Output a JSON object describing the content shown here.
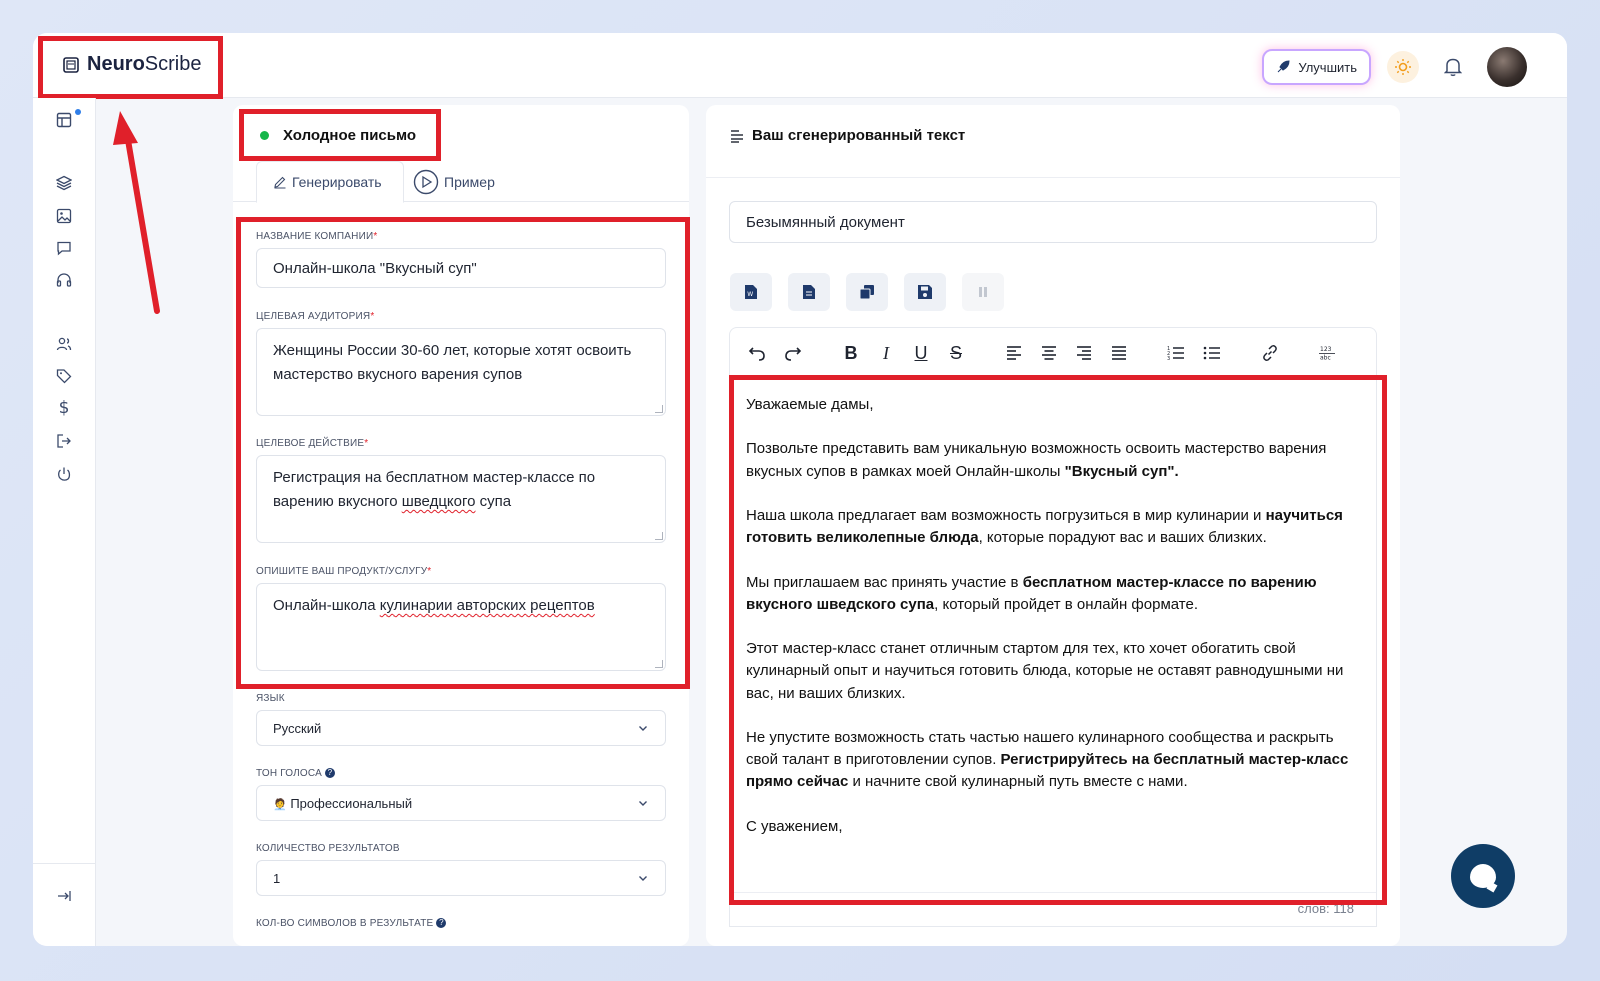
{
  "brand": {
    "name_bold": "Neuro",
    "name_light": "Scribe"
  },
  "header": {
    "upgrade_label": "Улучшить"
  },
  "sidebar": {
    "items": [
      "dashboard-icon",
      "layers-icon",
      "image-icon",
      "chat-icon",
      "headphones-icon",
      "users-icon",
      "tag-icon",
      "dollar-icon",
      "logout-icon",
      "power-icon"
    ],
    "collapse_icon": "collapse-icon"
  },
  "form": {
    "title": "Холодное письмо",
    "tabs": {
      "generate": "Генерировать",
      "example": "Пример"
    },
    "company": {
      "label": "НАЗВАНИЕ КОМПАНИИ",
      "value": "Онлайн-школа \"Вкусный суп\""
    },
    "audience": {
      "label": "ЦЕЛЕВАЯ АУДИТОРИЯ",
      "value": "Женщины России 30-60 лет, которые хотят освоить мастерство вкусного варения супов"
    },
    "action": {
      "label": "ЦЕЛЕВОЕ ДЕЙСТВИЕ",
      "value_a": "Регистрация на бесплатном мастер-классе по варению вкусного ",
      "value_b": "шведцкого",
      "value_c": " супа"
    },
    "product": {
      "label": "ОПИШИТЕ ВАШ ПРОДУКТ/УСЛУГУ",
      "value_a": "Онлайн-школа ",
      "value_b": "кулинарии авторских рецептов"
    },
    "language": {
      "label": "ЯЗЫК",
      "value": "Русский"
    },
    "tone": {
      "label": "ТОН ГОЛОСА",
      "value": "Профессиональный",
      "emoji": "🧑‍💼"
    },
    "results": {
      "label": "КОЛИЧЕСТВО РЕЗУЛЬТАТОВ",
      "value": "1"
    },
    "chars": {
      "label": "КОЛ-ВО СИМВОЛОВ В РЕЗУЛЬТАТЕ"
    }
  },
  "output": {
    "header": "Ваш сгенерированный текст",
    "doc_name": "Безымянный документ",
    "actions": [
      "word-icon",
      "doc-icon",
      "copy-icon",
      "save-icon",
      "pause-icon"
    ],
    "toolbar": [
      "undo-icon",
      "redo-icon",
      "bold-icon",
      "italic-icon",
      "underline-icon",
      "strikethrough-icon",
      "align-left-icon",
      "align-center-icon",
      "align-right-icon",
      "align-justify-icon",
      "ordered-list-icon",
      "bullet-list-icon",
      "link-icon",
      "spellcheck-icon"
    ],
    "p1": "Уважаемые дамы,",
    "p2a": "Позвольте представить вам уникальную возможность освоить мастерство варения вкусных супов в рамках моей Онлайн-школы ",
    "p2b": "\"Вкусный суп\".",
    "p3a": "Наша школа предлагает вам возможность погрузиться в мир кулинарии и ",
    "p3b": "научиться готовить великолепные блюда",
    "p3c": ", которые порадуют вас и ваших близких.",
    "p4a": "Мы приглашаем вас принять участие в ",
    "p4b": "бесплатном мастер-классе по варению вкусного шведского супа",
    "p4c": ", который пройдет в онлайн формате.",
    "p5": "Этот мастер-класс станет отличным стартом для тех, кто хочет обогатить свой кулинарный опыт и научиться готовить блюда, которые не оставят равнодушными ни вас, ни ваших близких.",
    "p6a": "Не упустите возможность стать частью нашего кулинарного сообщества и раскрыть свой талант в приготовлении супов. ",
    "p6b": "Регистрируйтесь на бесплатный мастер-класс прямо сейчас",
    "p6c": " и начните свой кулинарный путь вместе с нами.",
    "p7": "С уважением,",
    "word_count": "слов: 118"
  },
  "colors": {
    "annotation": "#e0202a",
    "accent": "#0f3d66",
    "status": "#17b64a"
  }
}
